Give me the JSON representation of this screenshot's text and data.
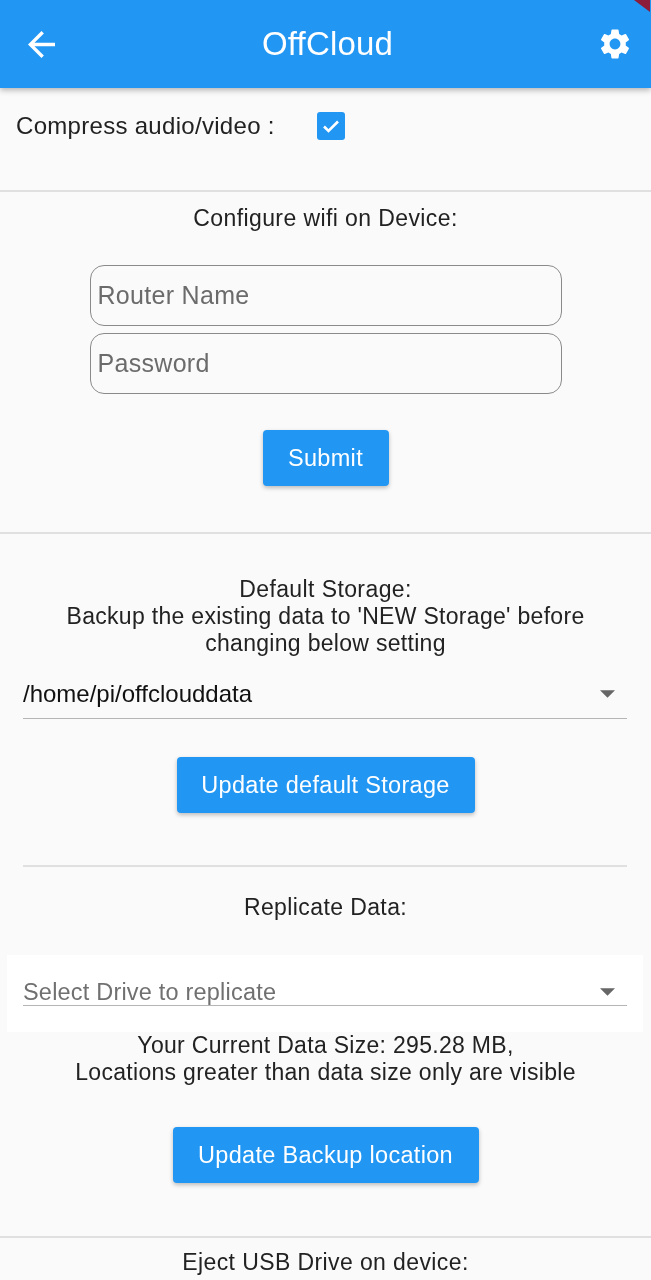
{
  "app_bar": {
    "title": "OffCloud"
  },
  "compress": {
    "label": "Compress audio/video :",
    "checked": true
  },
  "wifi": {
    "heading": "Configure wifi on Device:",
    "fields": [
      {
        "placeholder": "Router Name"
      },
      {
        "placeholder": "Password"
      }
    ],
    "button": "Submit"
  },
  "storage": {
    "heading": "Default Storage:",
    "note": "Backup the existing data to 'NEW Storage' before changing below setting",
    "dropdown": {
      "value": "/home/pi/offclouddata"
    },
    "button": "Update default Storage"
  },
  "replicate": {
    "heading": "Replicate Data:",
    "dropdown": {
      "placeholder": "Select Drive to replicate"
    },
    "info": [
      "Your Current Data Size: 295.28 MB,",
      "Locations greater than data size only are visible"
    ],
    "button": "Update Backup location"
  },
  "eject": {
    "heading": "Eject USB Drive on device:"
  }
}
